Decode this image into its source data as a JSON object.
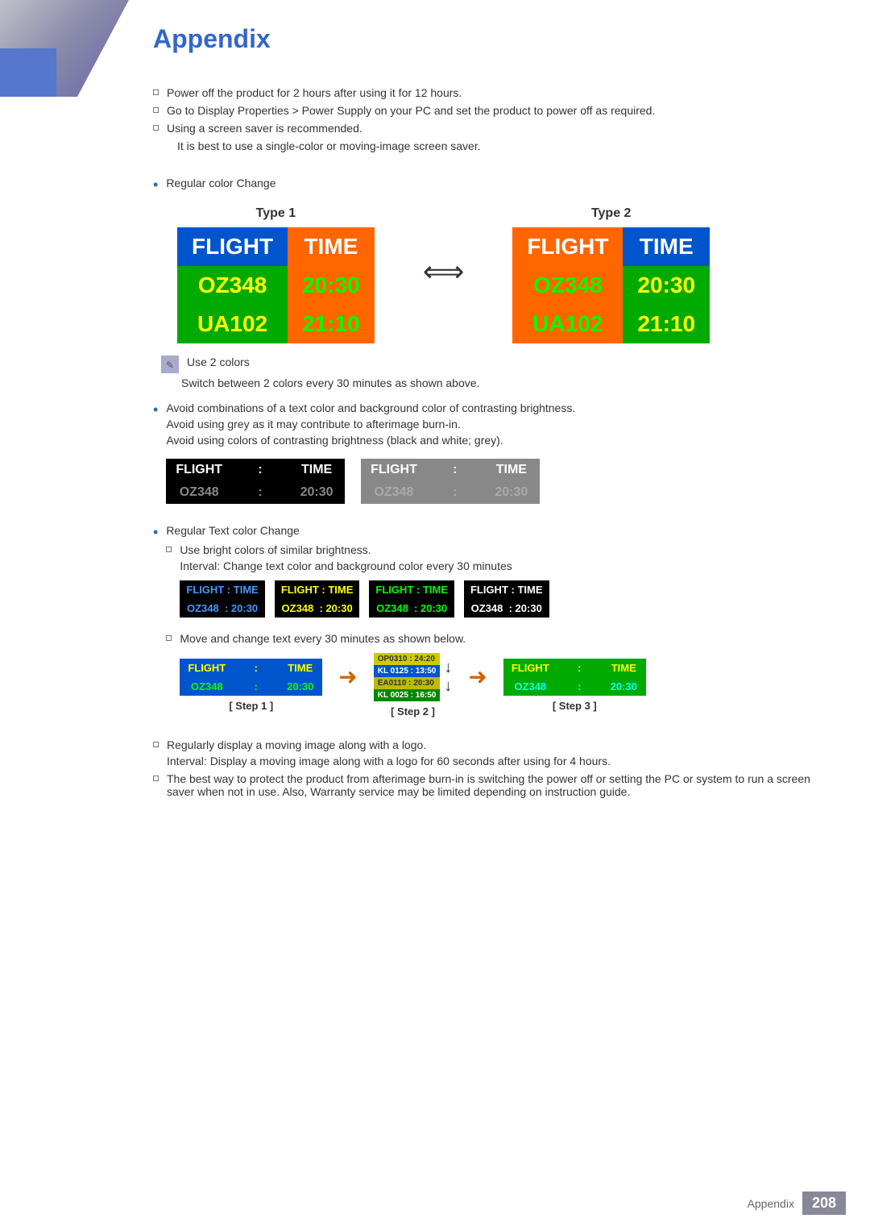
{
  "page": {
    "title": "Appendix",
    "footer_text": "Appendix",
    "footer_num": "208"
  },
  "bullets": {
    "b1": "Power off the product for 2 hours after using it for 12 hours.",
    "b2": "Go to Display Properties > Power Supply on your PC and set the product to power off as required.",
    "b3": "Using a screen saver is recommended.",
    "b3_sub": "It is best to use a single-color or moving-image screen saver.",
    "b4": "Regular color Change",
    "type1_label": "Type 1",
    "type2_label": "Type 2",
    "note_text": "Use 2 colors",
    "note_sub": "Switch between 2 colors every 30 minutes as shown above.",
    "b5a": "Avoid combinations of a text color and background color of contrasting brightness.",
    "b5b": "Avoid using grey as it may contribute to afterimage burn-in.",
    "b5c": "Avoid using colors of contrasting brightness (black and white; grey).",
    "b6": "Regular Text color Change",
    "b6a": "Use bright colors of similar brightness.",
    "b6a_sub": "Interval: Change text color and background color every 30 minutes",
    "b6b": "Move and change text every 30 minutes as shown below.",
    "step1_label": "[ Step 1 ]",
    "step2_label": "[ Step 2 ]",
    "step3_label": "[ Step 3 ]",
    "b7": "Regularly display a moving image along with a logo.",
    "b7_sub": "Interval: Display a moving image along with a logo for 60 seconds after using for 4 hours.",
    "b8": "The best way to protect the product from afterimage burn-in is switching the power off or setting the PC or system to run a screen saver when not in use. Also, Warranty service may be limited depending on instruction guide."
  },
  "flight_tables": {
    "t1_r1c1": "FLIGHT",
    "t1_r1c2": "TIME",
    "t1_r2c1": "OZ348",
    "t1_r2c2": "20:30",
    "t1_r3c1": "UA102",
    "t1_r3c2": "21:10",
    "t2_r1c1": "FLIGHT",
    "t2_r1c2": "TIME",
    "t2_r2c1": "OZ348",
    "t2_r2c2": "20:30",
    "t2_r3c1": "UA102",
    "t2_r3c2": "21:10"
  },
  "contrast_tables": {
    "ct1_r1c1": "FLIGHT",
    "ct1_r1c2": ":",
    "ct1_r1c3": "TIME",
    "ct1_r2c1": "OZ348",
    "ct1_r2c2": ":",
    "ct1_r2c3": "20:30",
    "ct2_r1c1": "FLIGHT",
    "ct2_r1c2": ":",
    "ct2_r1c3": "TIME",
    "ct2_r2c1": "OZ348",
    "ct2_r2c2": ":",
    "ct2_r2c3": "20:30"
  },
  "variant_tables": {
    "v1_h": "FLIGHT : TIME",
    "v1_d": "OZ348  :  20:30",
    "v2_h": "FLIGHT : TIME",
    "v2_d": "OZ348  :  20:30",
    "v3_h": "FLIGHT : TIME",
    "v3_d": "OZ348  :  20:30",
    "v4_h": "FLIGHT : TIME",
    "v4_d": "OZ348  :  20:30"
  },
  "step2_data": {
    "r1": "OP0310 :  24:20",
    "r2": "KL 0125 :  13:50",
    "r3": "EA0110 :  20:30",
    "r4": "KL 0025 :  16:50"
  }
}
